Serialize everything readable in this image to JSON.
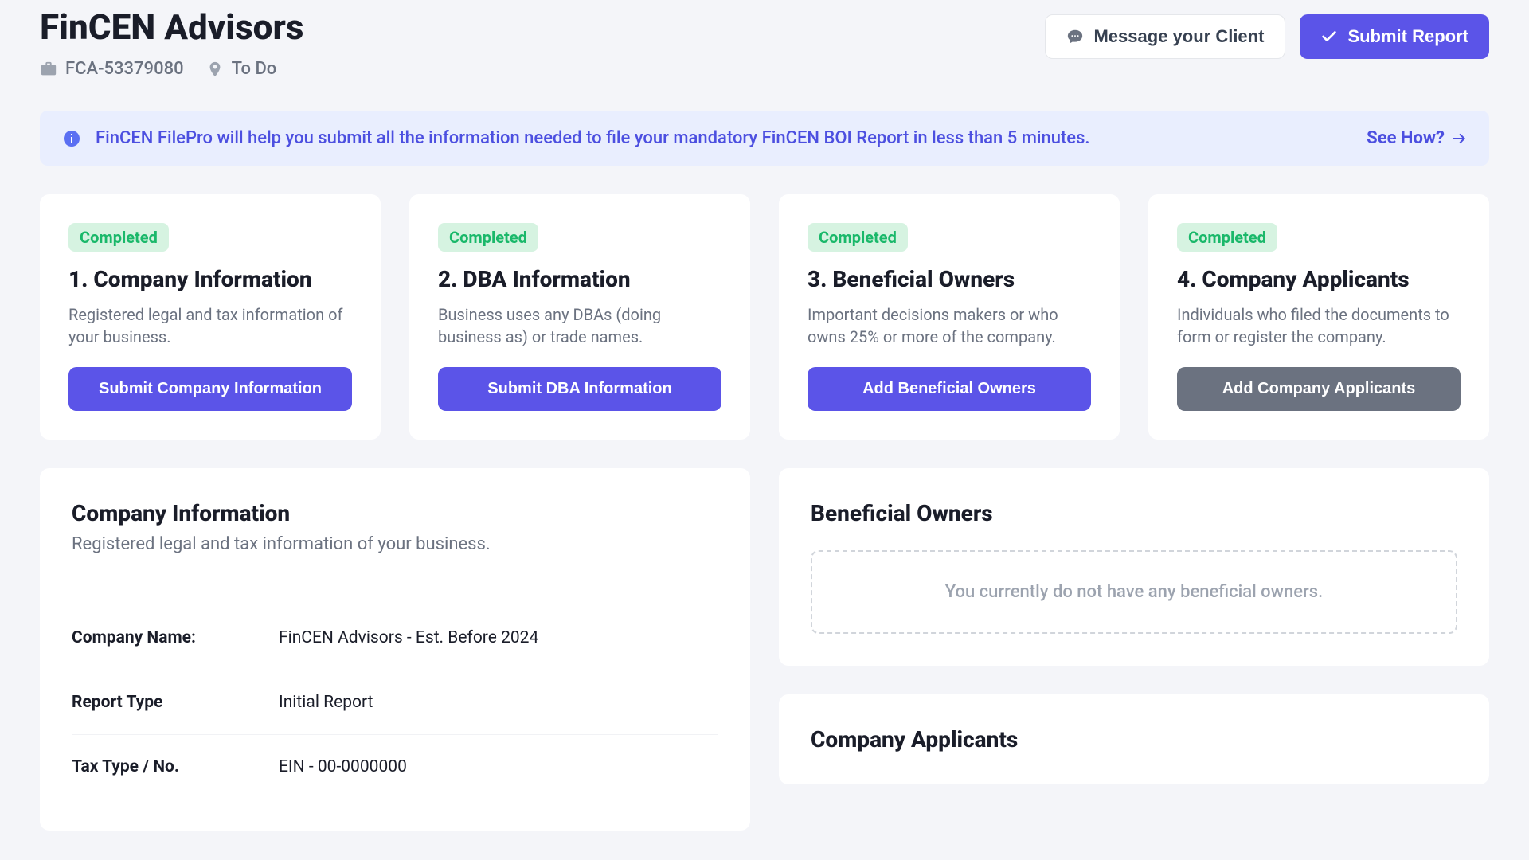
{
  "header": {
    "title": "FinCEN Advisors",
    "id": "FCA-53379080",
    "status": "To Do",
    "message_btn": "Message your Client",
    "submit_btn": "Submit Report"
  },
  "banner": {
    "text": "FinCEN FilePro will help you submit all the information needed to file your mandatory FinCEN BOI Report in less than 5 minutes.",
    "link": "See How?"
  },
  "cards": [
    {
      "badge": "Completed",
      "title": "1. Company Information",
      "desc": "Registered legal and tax information of your business.",
      "button": "Submit Company Information",
      "style": "primary"
    },
    {
      "badge": "Completed",
      "title": "2. DBA Information",
      "desc": "Business uses any DBAs (doing business as) or trade names.",
      "button": "Submit DBA Information",
      "style": "primary"
    },
    {
      "badge": "Completed",
      "title": "3. Beneficial Owners",
      "desc": "Important decisions makers or who owns 25% or more of the company.",
      "button": "Add Beneficial Owners",
      "style": "primary"
    },
    {
      "badge": "Completed",
      "title": "4. Company Applicants",
      "desc": "Individuals who filed the documents to form or register the company.",
      "button": "Add Company Applicants",
      "style": "gray"
    }
  ],
  "company_info": {
    "title": "Company Information",
    "subtitle": "Registered legal and tax information of your business.",
    "rows": [
      {
        "label": "Company Name:",
        "value": "FinCEN Advisors - Est. Before 2024"
      },
      {
        "label": "Report Type",
        "value": "Initial Report"
      },
      {
        "label": "Tax Type / No.",
        "value": "EIN - 00-0000000"
      }
    ]
  },
  "beneficial": {
    "title": "Beneficial Owners",
    "empty": "You currently do not have any beneficial owners."
  },
  "applicants": {
    "title": "Company Applicants"
  }
}
